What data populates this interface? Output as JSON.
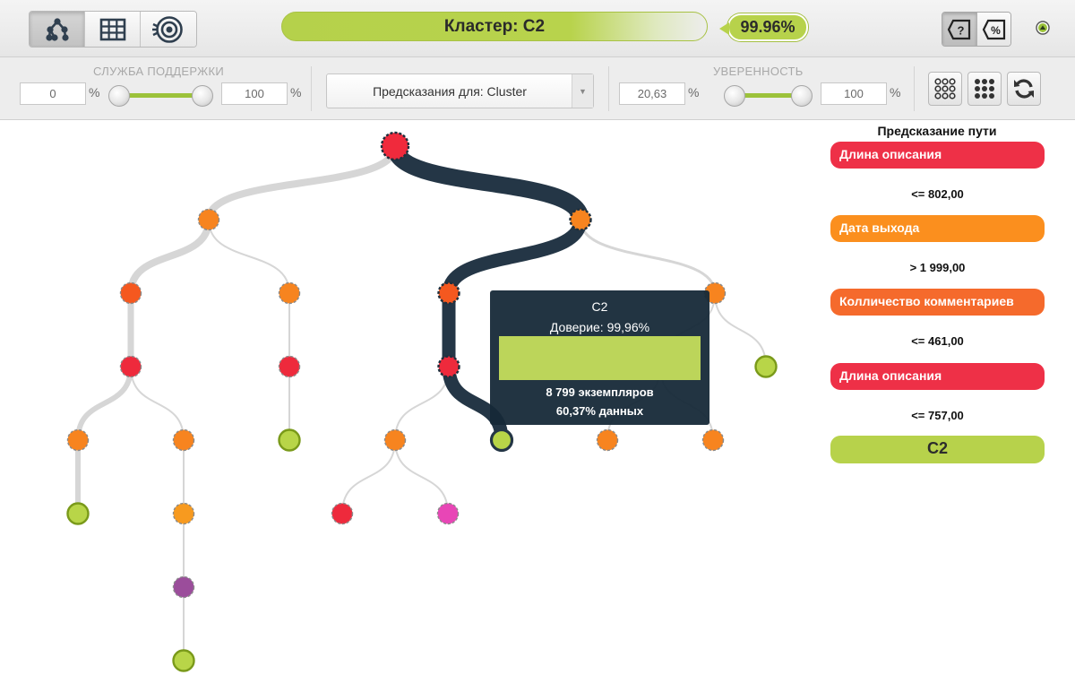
{
  "toolbar": {
    "views": [
      "tree-view-icon",
      "grid-view-icon",
      "sunburst-view-icon"
    ],
    "cluster_label": "Кластер: C2",
    "confidence": "99.96%",
    "colors": {
      "accent": "#b7d24b"
    }
  },
  "filters": {
    "support": {
      "label": "СЛУЖБА ПОДДЕРЖКИ",
      "min": "0",
      "max": "100",
      "unit": "%"
    },
    "predict_select": "Предсказания для: Cluster",
    "confidence": {
      "label": "УВЕРЕННОСТЬ",
      "min": "20,63",
      "max": "100",
      "unit": "%"
    }
  },
  "tooltip": {
    "class": "C2",
    "confidence": "Доверие: 99,96%",
    "instances": "8 799 экземпляров",
    "data_pct": "60,37% данных"
  },
  "path": {
    "title": "Предсказание пути",
    "steps": [
      {
        "field": "Длина описания",
        "rule": "<= 802,00",
        "color": "#ee3047"
      },
      {
        "field": "Дата выхода",
        "rule": "> 1 999,00",
        "color": "#fb8f1e"
      },
      {
        "field": "Колличество комментариев",
        "rule": "<= 461,00",
        "color": "#f56a2c"
      },
      {
        "field": "Длина описания",
        "rule": "<= 757,00",
        "color": "#ee3047"
      }
    ],
    "result": "C2"
  },
  "tree": {
    "colors": {
      "path": "#243646",
      "edge": "#d6d6d6",
      "leaf": "#b8d548"
    },
    "nodes": [
      {
        "id": "root",
        "fill": "#f02a3c",
        "kind": "split",
        "on_path": true
      },
      {
        "id": "n1",
        "parent": "root",
        "fill": "#f7841f",
        "kind": "split",
        "weight": 8
      },
      {
        "id": "n2",
        "parent": "root",
        "fill": "#f7841f",
        "kind": "split",
        "weight": 16,
        "on_path": true
      },
      {
        "id": "n3",
        "parent": "n1",
        "fill": "#f5581f",
        "kind": "split",
        "weight": 8
      },
      {
        "id": "n4",
        "parent": "n1",
        "fill": "#f7841f",
        "kind": "split",
        "weight": 2
      },
      {
        "id": "n5",
        "parent": "n2",
        "fill": "#f5581f",
        "kind": "split",
        "weight": 12,
        "on_path": true
      },
      {
        "id": "n6",
        "parent": "n2",
        "fill": "#f7841f",
        "kind": "split",
        "weight": 3
      },
      {
        "id": "n7",
        "parent": "n3",
        "fill": "#ee2a3c",
        "kind": "split",
        "weight": 7
      },
      {
        "id": "n8",
        "parent": "n4",
        "fill": "#ee2a3c",
        "kind": "split",
        "weight": 2
      },
      {
        "id": "n9",
        "parent": "n5",
        "fill": "#ee2a3c",
        "kind": "split",
        "weight": 12,
        "on_path": true
      },
      {
        "id": "n10",
        "parent": "n6",
        "fill": "#f7841f",
        "kind": "split",
        "weight": 2
      },
      {
        "id": "n11",
        "parent": "n6",
        "fill": "#b8d548",
        "kind": "leaf",
        "weight": 2
      },
      {
        "id": "n12",
        "parent": "n7",
        "fill": "#f7841f",
        "kind": "split",
        "weight": 6
      },
      {
        "id": "n13",
        "parent": "n7",
        "fill": "#f7841f",
        "kind": "split",
        "weight": 2
      },
      {
        "id": "n14",
        "parent": "n8",
        "fill": "#b8d548",
        "kind": "leaf",
        "weight": 2
      },
      {
        "id": "n15",
        "parent": "n9",
        "fill": "#f7841f",
        "kind": "split",
        "weight": 2
      },
      {
        "id": "n16",
        "parent": "n9",
        "fill": "#b8d548",
        "kind": "leaf",
        "weight": 12,
        "on_path": true
      },
      {
        "id": "n17",
        "parent": "n10",
        "fill": "#f7841f",
        "kind": "split",
        "weight": 2
      },
      {
        "id": "n18",
        "parent": "n10",
        "fill": "#f7841f",
        "kind": "split",
        "weight": 2
      },
      {
        "id": "n19",
        "parent": "n12",
        "fill": "#b8d548",
        "kind": "leaf",
        "weight": 6
      },
      {
        "id": "n20",
        "parent": "n13",
        "fill": "#f79a1f",
        "kind": "split",
        "weight": 2
      },
      {
        "id": "n21",
        "parent": "n15",
        "fill": "#ee2a3c",
        "kind": "split",
        "weight": 2
      },
      {
        "id": "n22",
        "parent": "n15",
        "fill": "#e846b6",
        "kind": "split",
        "weight": 2
      },
      {
        "id": "n23",
        "parent": "n20",
        "fill": "#9b4d9b",
        "kind": "split",
        "weight": 2
      },
      {
        "id": "n24",
        "parent": "n23",
        "fill": "#b8d548",
        "kind": "leaf",
        "weight": 2
      }
    ]
  }
}
